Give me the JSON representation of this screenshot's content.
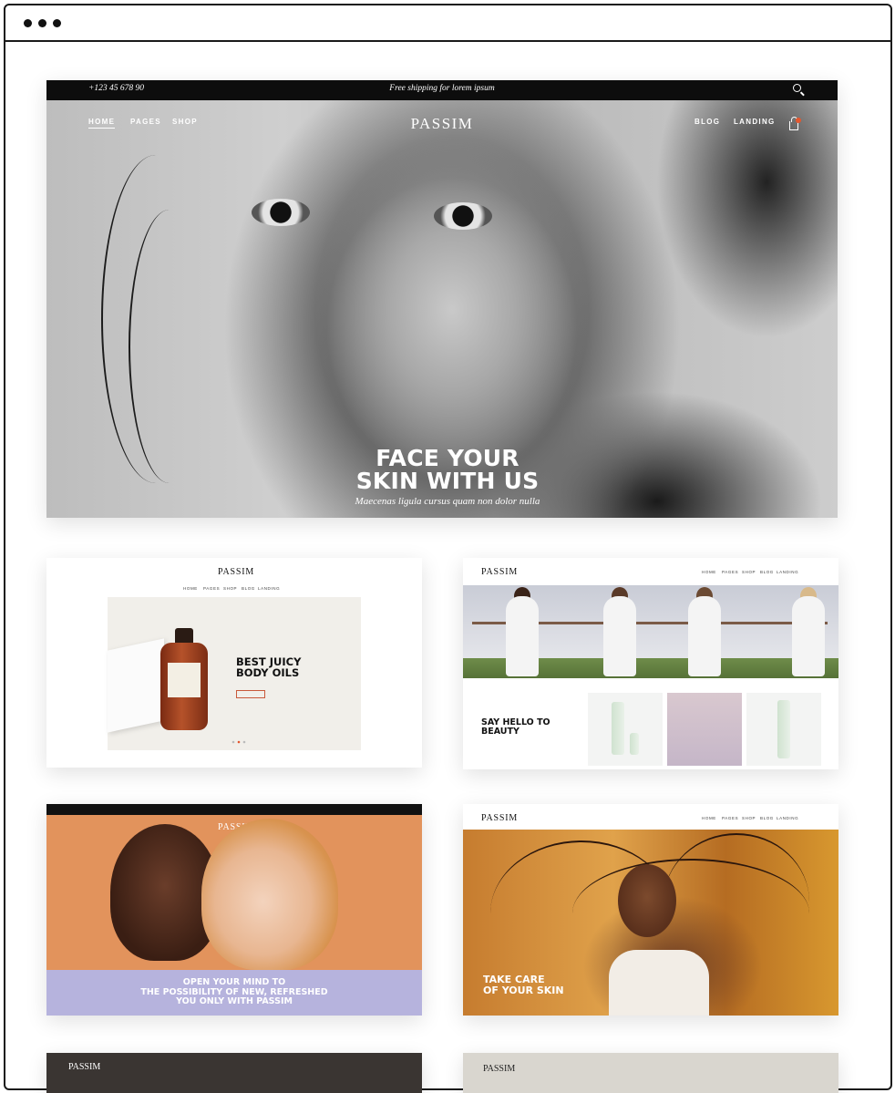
{
  "hero": {
    "phone": "+123 45 678 90",
    "shipping": "Free shipping for lorem ipsum",
    "brand": "PASSIM",
    "nav_left": [
      "HOME",
      "PAGES",
      "SHOP"
    ],
    "nav_right": [
      "BLOG",
      "LANDING"
    ],
    "title_line1": "FACE YOUR",
    "title_line2": "SKIN WITH US",
    "subtitle": "Maecenas ligula cursus quam non dolor nulla"
  },
  "demo1": {
    "brand": "PASSIM",
    "nav": [
      "HOME",
      "PAGES",
      "SHOP",
      "BLOG",
      "LANDING"
    ],
    "title_line1": "BEST JUICY",
    "title_line2": "BODY OILS"
  },
  "demo2": {
    "brand": "PASSIM",
    "nav": [
      "HOME",
      "PAGES",
      "SHOP",
      "BLOG",
      "LANDING"
    ],
    "title_line1": "SAY HELLO TO",
    "title_line2": "BEAUTY"
  },
  "demo3": {
    "brand": "PASSIM",
    "title_line1": "OPEN YOUR MIND TO",
    "title_line2": "THE POSSIBILITY OF NEW, REFRESHED",
    "title_line3": "YOU ONLY WITH PASSIM"
  },
  "demo4": {
    "brand": "PASSIM",
    "nav": [
      "HOME",
      "PAGES",
      "SHOP",
      "BLOG",
      "LANDING"
    ],
    "title_line1": "TAKE CARE",
    "title_line2": "OF YOUR SKIN"
  },
  "demo5": {
    "brand": "PASSIM"
  },
  "demo6": {
    "brand": "PASSIM"
  },
  "colors": {
    "accent": "#e4572e",
    "lavender": "#b6b3dd",
    "dark": "#0d0d0d"
  },
  "icons": [
    "search-icon",
    "cart-icon",
    "window-dots-icon"
  ]
}
